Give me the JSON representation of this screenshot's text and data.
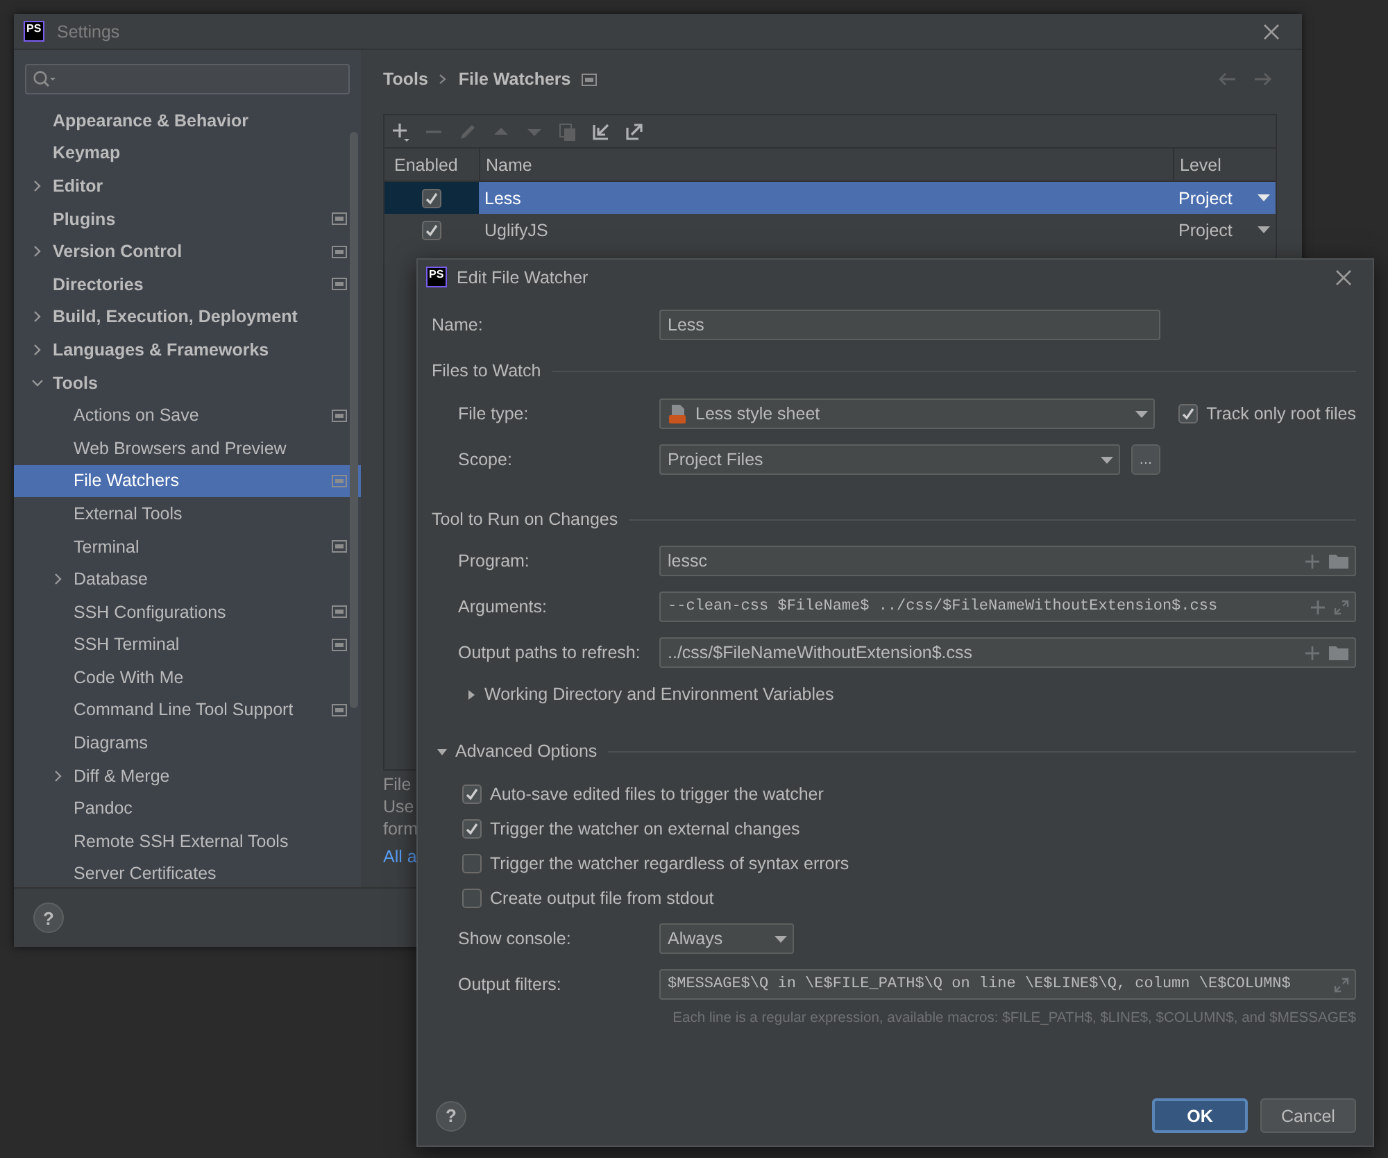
{
  "settings": {
    "logo": "PS",
    "title": "Settings",
    "sidebar": {
      "items": [
        {
          "label": "Appearance & Behavior",
          "kind": "page",
          "project_level": false,
          "selected": false
        },
        {
          "label": "Keymap",
          "kind": "page",
          "project_level": false,
          "selected": false
        },
        {
          "label": "Editor",
          "kind": "group",
          "expanded": false,
          "project_level": false,
          "selected": false
        },
        {
          "label": "Plugins",
          "kind": "page",
          "project_level": true,
          "selected": false
        },
        {
          "label": "Version Control",
          "kind": "group",
          "expanded": false,
          "project_level": true,
          "selected": false
        },
        {
          "label": "Directories",
          "kind": "page",
          "project_level": true,
          "selected": false
        },
        {
          "label": "Build, Execution, Deployment",
          "kind": "group",
          "expanded": false,
          "project_level": false,
          "selected": false
        },
        {
          "label": "Languages & Frameworks",
          "kind": "group",
          "expanded": false,
          "project_level": false,
          "selected": false
        },
        {
          "label": "Tools",
          "kind": "group",
          "expanded": true,
          "project_level": false,
          "selected": false,
          "children": [
            {
              "label": "Actions on Save",
              "kind": "page",
              "project_level": true,
              "selected": false
            },
            {
              "label": "Web Browsers and Preview",
              "kind": "page",
              "project_level": false,
              "selected": false
            },
            {
              "label": "File Watchers",
              "kind": "page",
              "project_level": true,
              "selected": true
            },
            {
              "label": "External Tools",
              "kind": "page",
              "project_level": false,
              "selected": false
            },
            {
              "label": "Terminal",
              "kind": "page",
              "project_level": true,
              "selected": false
            },
            {
              "label": "Database",
              "kind": "group",
              "expanded": false,
              "project_level": false,
              "selected": false
            },
            {
              "label": "SSH Configurations",
              "kind": "page",
              "project_level": true,
              "selected": false
            },
            {
              "label": "SSH Terminal",
              "kind": "page",
              "project_level": true,
              "selected": false
            },
            {
              "label": "Code With Me",
              "kind": "page",
              "project_level": false,
              "selected": false
            },
            {
              "label": "Command Line Tool Support",
              "kind": "page",
              "project_level": true,
              "selected": false
            },
            {
              "label": "Diagrams",
              "kind": "page",
              "project_level": false,
              "selected": false
            },
            {
              "label": "Diff & Merge",
              "kind": "group",
              "expanded": false,
              "project_level": false,
              "selected": false
            },
            {
              "label": "Pandoc",
              "kind": "page",
              "project_level": false,
              "selected": false
            },
            {
              "label": "Remote SSH External Tools",
              "kind": "page",
              "project_level": false,
              "selected": false
            },
            {
              "label": "Server Certificates",
              "kind": "page",
              "project_level": false,
              "selected": false
            }
          ]
        }
      ]
    },
    "breadcrumb": [
      "Tools",
      "File Watchers"
    ],
    "navigation": [
      {
        "kind": "back",
        "disabled": true
      },
      {
        "kind": "forward",
        "disabled": true
      }
    ],
    "toolbar": [
      {
        "kind": "add",
        "disabled": false
      },
      {
        "kind": "remove",
        "disabled": true
      },
      {
        "kind": "edit",
        "disabled": true
      },
      {
        "kind": "move_up",
        "disabled": true
      },
      {
        "kind": "move_down",
        "disabled": true
      },
      {
        "kind": "copy",
        "disabled": true
      },
      {
        "kind": "import",
        "disabled": false
      },
      {
        "kind": "export",
        "disabled": false
      }
    ],
    "table": {
      "columns": [
        "Enabled",
        "Name",
        "Level"
      ],
      "rows": [
        {
          "enabled": true,
          "name": "Less",
          "level": "Project",
          "selected": true
        },
        {
          "enabled": true,
          "name": "UglifyJS",
          "level": "Project",
          "selected": false
        }
      ]
    },
    "description_lines": [
      "File",
      "Use",
      "form"
    ],
    "link": "All a",
    "help_button": "?"
  },
  "edit_dialog": {
    "logo": "PS",
    "title": "Edit File Watcher",
    "name": {
      "label": "Name:",
      "value": "Less"
    },
    "files_to_watch": {
      "heading": "Files to Watch",
      "file_type": {
        "label": "File type:",
        "value": "Less style sheet"
      },
      "track_only_root_files": {
        "label": "Track only root files",
        "checked": true
      },
      "scope": {
        "label": "Scope:",
        "value": "Project Files",
        "browse_button": "..."
      }
    },
    "tool_to_run": {
      "heading": "Tool to Run on Changes",
      "program": {
        "label": "Program:",
        "value": "lessc"
      },
      "arguments": {
        "label": "Arguments:",
        "value": "--clean-css $FileName$ ../css/$FileNameWithoutExtension$.css"
      },
      "output_paths": {
        "label": "Output paths to refresh:",
        "value": "../css/$FileNameWithoutExtension$.css"
      },
      "working_directory": {
        "label": "Working Directory and Environment Variables",
        "expanded": false
      }
    },
    "advanced_options": {
      "heading": "Advanced Options",
      "expanded": true,
      "options": [
        {
          "label": "Auto-save edited files to trigger the watcher",
          "checked": true
        },
        {
          "label": "Trigger the watcher on external changes",
          "checked": true
        },
        {
          "label": "Trigger the watcher regardless of syntax errors",
          "checked": false
        },
        {
          "label": "Create output file from stdout",
          "checked": false
        }
      ],
      "show_console": {
        "label": "Show console:",
        "value": "Always"
      },
      "output_filters": {
        "label": "Output filters:",
        "value": "$MESSAGE$\\Q in \\E$FILE_PATH$\\Q on line \\E$LINE$\\Q, column \\E$COLUMN$"
      },
      "hint": "Each line is a regular expression, available macros: $FILE_PATH$, $LINE$, $COLUMN$, and $MESSAGE$"
    },
    "buttons": [
      {
        "label": "OK",
        "default": true
      },
      {
        "label": "Cancel",
        "default": false
      }
    ],
    "help_button": "?"
  }
}
